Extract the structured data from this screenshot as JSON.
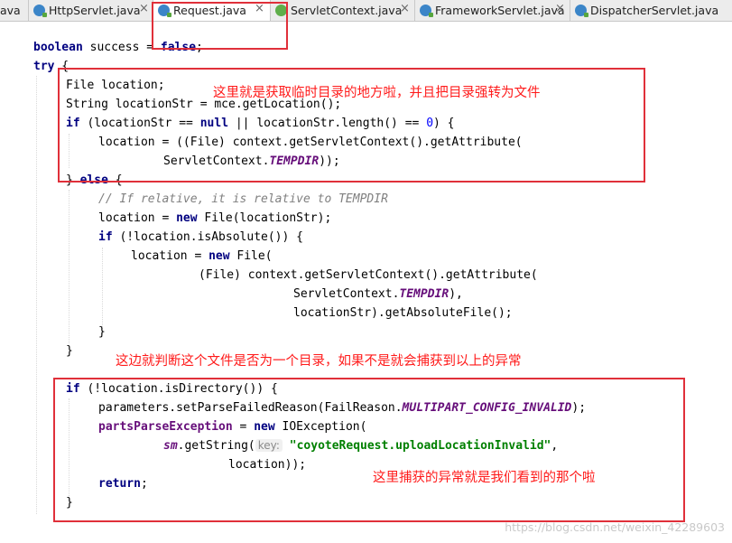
{
  "tabs": [
    {
      "label": "ava",
      "icon": "none"
    },
    {
      "label": "HttpServlet.java",
      "icon": "class-icon"
    },
    {
      "label": "Request.java",
      "icon": "class-icon",
      "active": true
    },
    {
      "label": "ServletContext.java",
      "icon": "interface-icon"
    },
    {
      "label": "FrameworkServlet.java",
      "icon": "class-icon"
    },
    {
      "label": "DispatcherServlet.java",
      "icon": "class-icon"
    }
  ],
  "close_glyph": "×",
  "code": {
    "t1a": "boolean",
    "t1b": " success = ",
    "t1c": "false",
    "t1d": ";",
    "t2a": "try",
    "t2b": " {",
    "t3": "File location;",
    "t4": "String locationStr = mce.getLocation();",
    "t5a": "if",
    "t5b": " (locationStr == ",
    "t5c": "null",
    "t5d": " || locationStr.length() == ",
    "t5e": "0",
    "t5f": ") {",
    "t6": "location = ((File) context.getServletContext().getAttribute(",
    "t7a": "ServletContext.",
    "t7b": "TEMPDIR",
    "t7c": "));",
    "t8a": "} ",
    "t8b": "else",
    "t8c": " {",
    "t9": "// If relative, it is relative to TEMPDIR",
    "t10a": "location = ",
    "t10b": "new",
    "t10c": " File(locationStr);",
    "t11a": "if",
    "t11b": " (!location.isAbsolute()) {",
    "t12a": "location = ",
    "t12b": "new",
    "t12c": " File(",
    "t13": "(File) context.getServletContext().getAttribute(",
    "t14a": "ServletContext.",
    "t14b": "TEMPDIR",
    "t14c": "),",
    "t15": "locationStr).getAbsoluteFile();",
    "t16": "}",
    "t17": "}",
    "t18a": "if",
    "t18b": " (!location.isDirectory()) {",
    "t19a": "parameters.setParseFailedReason(FailReason.",
    "t19b": "MULTIPART_CONFIG_INVALID",
    "t19c": ");",
    "t20a": "partsParseException",
    "t20b": " = ",
    "t20c": "new",
    "t20d": " IOException(",
    "t21a": "sm",
    "t21b": ".getString(",
    "t21c": "key:",
    "t21d": " ",
    "t21e": "\"coyoteRequest.uploadLocationInvalid\"",
    "t21f": ",",
    "t22": "location));",
    "t23a": "return",
    "t23b": ";",
    "t24": "}"
  },
  "annotations": {
    "note1": "这里就是获取临时目录的地方啦，并且把目录强转为文件",
    "note2": "这边就判断这个文件是否为一个目录，如果不是就会捕获到以上的异常",
    "note3": "这里捕获的异常就是我们看到的那个啦"
  },
  "watermark": "https://blog.csdn.net/weixin_42289603",
  "colors": {
    "annotation": "#ff1a1a",
    "keyword": "#000080",
    "string": "#008000",
    "constant": "#660e7a",
    "comment": "#808080"
  }
}
